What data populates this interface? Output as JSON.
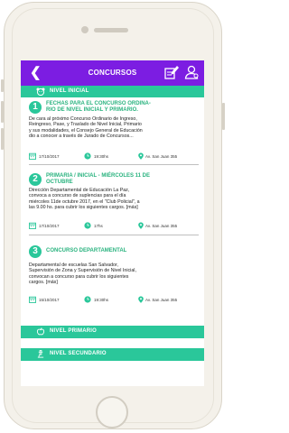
{
  "header": {
    "title": "CONCURSOS",
    "back_icon": "chevron-left-icon",
    "action_icons": [
      "edit-document-icon",
      "user-settings-icon"
    ]
  },
  "colors": {
    "header_bg": "#7c1de2",
    "accent": "#2ac79a",
    "title_text": "#2ab37f"
  },
  "sections": {
    "inicial": {
      "label": "NIVEL INICIAL",
      "icon": "bear-face-icon"
    },
    "primario": {
      "label": "NIVEL PRIMARIO",
      "icon": "apple-icon"
    },
    "secundario": {
      "label": "NIVEL SECUNDARIO",
      "icon": "microscope-icon"
    }
  },
  "items": [
    {
      "number": "1",
      "title_line1": "FECHAS PARA EL CONCURSO ORDINA-",
      "title_line2": "RIO DE NIVEL INICIAL Y PRIMARIO.",
      "body": [
        "De cara al próximo Concurso Ordinario de Ingreso,",
        "Reingreso, Pase, y Traslado de Nivel Inicial, Primario",
        "y sus modalidades, el Consejo General de Educación",
        "dio a conocer a través de Jurado de Concursos..."
      ],
      "date": "17/10/2017",
      "time": "19:30hs",
      "place": "Av. San Juan 355"
    },
    {
      "number": "2",
      "title_line1": "PRIMARIA / INICIAL - MIÉRCOLES 11 DE",
      "title_line2": "OCTUBRE",
      "body": [
        "Dirección Departamental de Educación La Paz,",
        "convoca a concurso de suplencias para el día",
        "miércoles 11de octubre 2017, en el \"Club Policial\", a",
        "las 9.00 hs. para cubrir los siguientes cargos. [más]"
      ],
      "date": "17/10/2017",
      "time": "17hs",
      "place": "Av. San Juan 355"
    },
    {
      "number": "3",
      "title_line1": "CONCURSO DEPARTAMENTAL",
      "title_line2": "",
      "body": [
        "Departamental de escuelas San Salvador,",
        "Supervisión de Zona y Supervisión de Nivel Inicial,",
        "convocan a concurso para cubrir los siguientes",
        "cargos. [más]"
      ],
      "date": "15/10/2017",
      "time": "19:30hs",
      "place": "Av. San Juan 355"
    }
  ]
}
